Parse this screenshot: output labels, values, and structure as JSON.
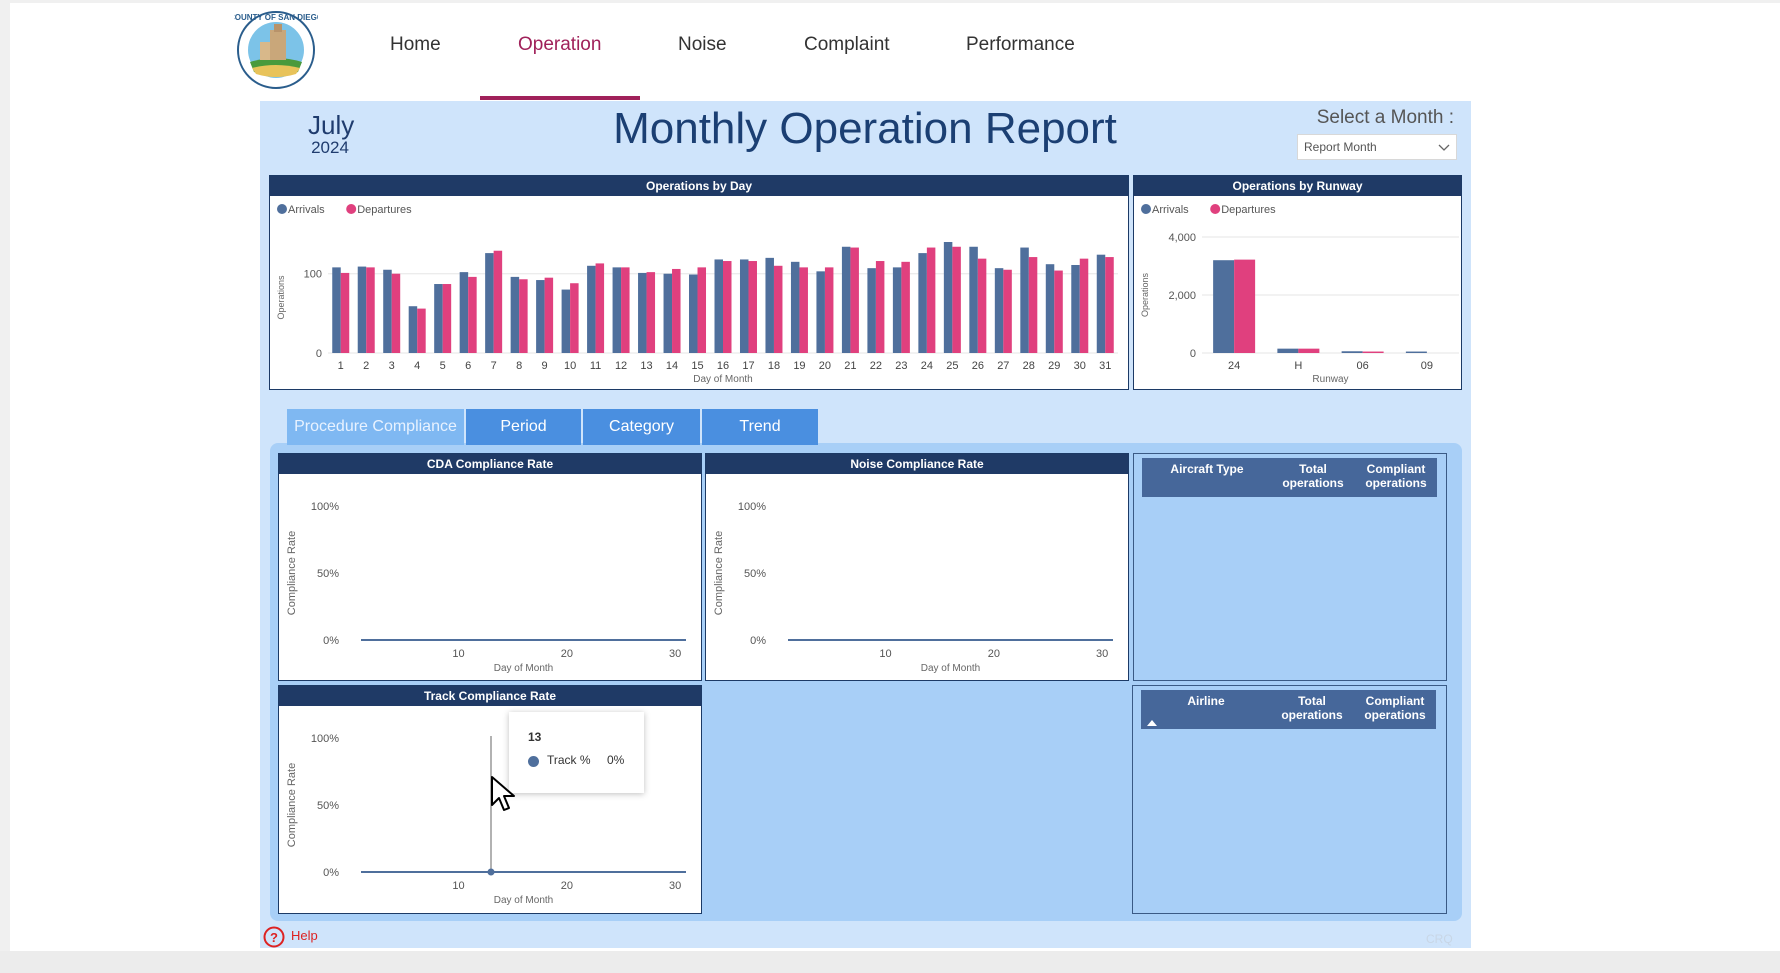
{
  "nav": {
    "items": [
      "Home",
      "Operation",
      "Noise",
      "Complaint",
      "Performance"
    ],
    "active": "Operation"
  },
  "header": {
    "month": "July",
    "year": "2024",
    "title": "Monthly Operation Report",
    "select_label": "Select a Month :",
    "select_value": "Report Month"
  },
  "tabs": [
    "Procedure Compliance",
    "Period",
    "Category",
    "Trend"
  ],
  "help_label": "Help",
  "footer_tag": "CRQ",
  "colors": {
    "arrivals": "#4f6f9c",
    "departures": "#e0407e",
    "header": "#1f3a66",
    "accent": "#a0215a"
  },
  "chart_data": [
    {
      "id": "ops-by-day",
      "type": "bar",
      "title": "Operations by Day",
      "xlabel": "Day of Month",
      "ylabel": "Operations",
      "ylim": [
        0,
        140
      ],
      "yticks": [
        "0",
        "100"
      ],
      "legend": "top-left",
      "categories": [
        "1",
        "2",
        "3",
        "4",
        "5",
        "6",
        "7",
        "8",
        "9",
        "10",
        "11",
        "12",
        "13",
        "14",
        "15",
        "16",
        "17",
        "18",
        "19",
        "20",
        "21",
        "22",
        "23",
        "24",
        "25",
        "26",
        "27",
        "28",
        "29",
        "30",
        "31"
      ],
      "series": [
        {
          "name": "Arrivals",
          "values": [
            108,
            109,
            105,
            59,
            87,
            102,
            126,
            96,
            92,
            80,
            110,
            108,
            101,
            100,
            99,
            118,
            118,
            120,
            115,
            103,
            134,
            107,
            108,
            126,
            140,
            134,
            107,
            133,
            112,
            111,
            124
          ]
        },
        {
          "name": "Departures",
          "values": [
            101,
            108,
            100,
            56,
            87,
            96,
            129,
            93,
            95,
            88,
            113,
            108,
            102,
            106,
            108,
            116,
            116,
            110,
            108,
            108,
            133,
            116,
            115,
            133,
            134,
            119,
            105,
            121,
            104,
            119,
            121
          ]
        }
      ]
    },
    {
      "id": "ops-by-runway",
      "type": "bar",
      "title": "Operations by Runway",
      "xlabel": "Runway",
      "ylabel": "Operations",
      "ylim": [
        0,
        4000
      ],
      "yticks": [
        "0",
        "2,000",
        "4,000"
      ],
      "legend": "top-left",
      "categories": [
        "24",
        "H",
        "06",
        "09"
      ],
      "series": [
        {
          "name": "Arrivals",
          "values": [
            3200,
            150,
            60,
            50
          ]
        },
        {
          "name": "Departures",
          "values": [
            3220,
            150,
            50,
            0
          ]
        }
      ]
    },
    {
      "id": "cda-compliance",
      "type": "line",
      "title": "CDA Compliance Rate",
      "xlabel": "Day of Month",
      "ylabel": "Compliance Rate",
      "yticks": [
        "0%",
        "50%",
        "100%"
      ],
      "xticks": [
        "10",
        "20",
        "30"
      ],
      "x": [
        1,
        31
      ],
      "y": [
        0,
        0
      ]
    },
    {
      "id": "noise-compliance",
      "type": "line",
      "title": "Noise Compliance Rate",
      "xlabel": "Day of Month",
      "ylabel": "Compliance Rate",
      "yticks": [
        "0%",
        "50%",
        "100%"
      ],
      "xticks": [
        "10",
        "20",
        "30"
      ],
      "x": [
        1,
        31
      ],
      "y": [
        0,
        0
      ]
    },
    {
      "id": "track-compliance",
      "type": "line",
      "title": "Track Compliance Rate",
      "xlabel": "Day of Month",
      "ylabel": "Compliance Rate",
      "yticks": [
        "0%",
        "50%",
        "100%"
      ],
      "xticks": [
        "10",
        "20",
        "30"
      ],
      "x": [
        1,
        31
      ],
      "y": [
        0,
        0
      ],
      "tooltip": {
        "day": "13",
        "series": "Track %",
        "value": "0%"
      }
    }
  ],
  "tables": {
    "aircraft": {
      "headers": [
        "Aircraft Type",
        "Total operations",
        "Compliant operations"
      ]
    },
    "airline": {
      "headers": [
        "Airline",
        "Total operations",
        "Compliant operations"
      ]
    }
  }
}
